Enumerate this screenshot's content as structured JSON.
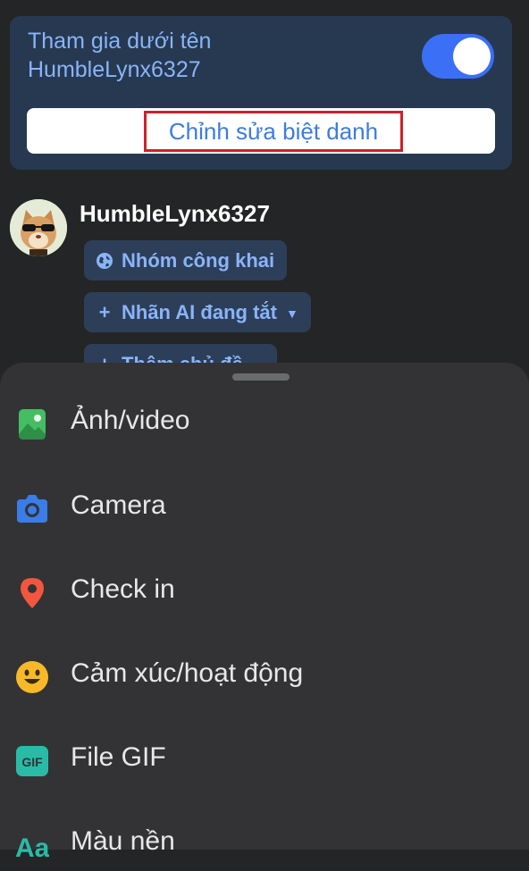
{
  "identity": {
    "join_as_text": "Tham gia dưới tên HumbleLynx6327",
    "toggle_on": true,
    "edit_nickname_label": "Chỉnh sửa biệt danh"
  },
  "author": {
    "name": "HumbleLynx6327"
  },
  "chips": [
    {
      "label": "Nhóm công khai",
      "icon": "globe-icon"
    },
    {
      "label": "Nhãn AI đang tắt",
      "icon": "plus-icon"
    },
    {
      "label": "Thêm chủ đề",
      "icon": "plus-icon"
    }
  ],
  "sheet": {
    "items": [
      {
        "label": "Ảnh/video",
        "icon": "photo-icon",
        "color": "#45bd62"
      },
      {
        "label": "Camera",
        "icon": "camera-icon",
        "color": "#3a7ce8"
      },
      {
        "label": "Check in",
        "icon": "location-pin-icon",
        "color": "#f3563f"
      },
      {
        "label": "Cảm xúc/hoạt động",
        "icon": "smiley-icon",
        "color": "#f7b928"
      },
      {
        "label": "File GIF",
        "icon": "gif-icon",
        "color": "#2abba7"
      },
      {
        "label": "Màu nền",
        "icon": "text-style-icon",
        "color": "#2abba7"
      }
    ]
  }
}
